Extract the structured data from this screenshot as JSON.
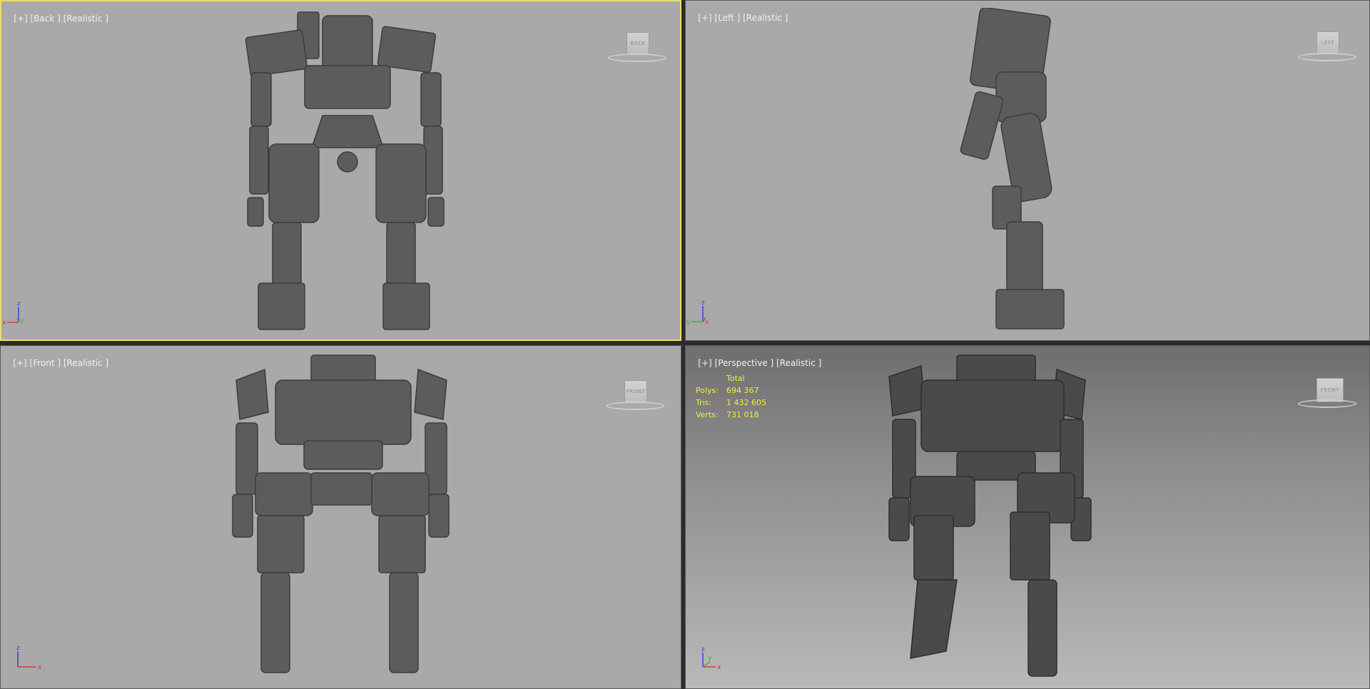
{
  "viewports": {
    "back": {
      "plus": "[+]",
      "view": "[Back ]",
      "shading": "[Realistic ]",
      "cube": "BACK",
      "axes": {
        "up": "z",
        "left": "x",
        "right": "y"
      }
    },
    "left": {
      "plus": "[+]",
      "view": "[Left ]",
      "shading": "[Realistic ]",
      "cube": "LEFT",
      "axes": {
        "up": "z",
        "left": "y",
        "right": "x"
      }
    },
    "front": {
      "plus": "[+]",
      "view": "[Front ]",
      "shading": "[Realistic ]",
      "cube": "FRONT",
      "axes": {
        "up": "z",
        "right": "x"
      }
    },
    "perspective": {
      "plus": "[+]",
      "view": "[Perspective ]",
      "shading": "[Realistic ]",
      "cube": "FRONT",
      "axes": {
        "up": "z",
        "mid": "y",
        "right": "x"
      }
    }
  },
  "stats": {
    "title": "Total",
    "polys_label": "Polys:",
    "polys_value": "694 367",
    "tris_label": "Tris:",
    "tris_value": "1 432 605",
    "verts_label": "Verts:",
    "verts_value": "731 018"
  },
  "colors": {
    "active_border": "#e8dd6a",
    "viewport_bg": "#a9a9a9",
    "stats_text": "#f2ec3c",
    "axis_x": "#d63a3a",
    "axis_y": "#3fae3f",
    "axis_z": "#3a3ad6"
  }
}
